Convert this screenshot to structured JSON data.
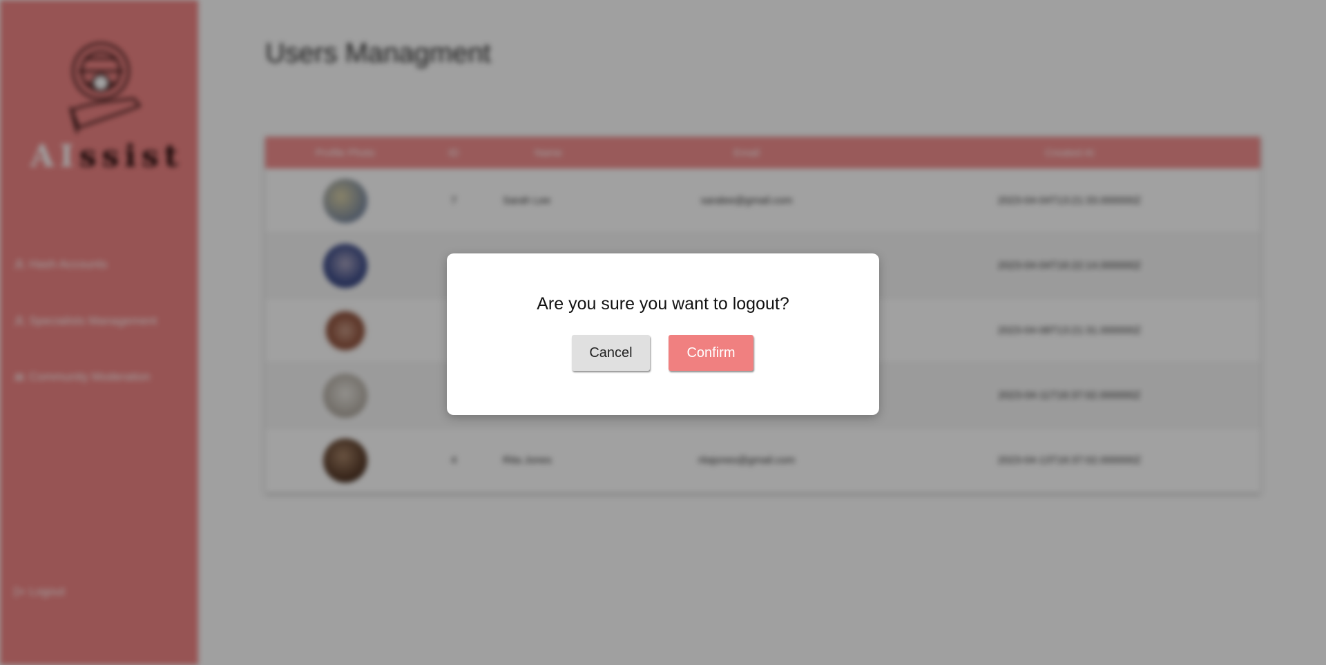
{
  "sidebar": {
    "brand_part1": "AI",
    "brand_part2": "ssist",
    "items": [
      {
        "label": "Hash Accounts",
        "icon": "user-icon"
      },
      {
        "label": "Specialists Management",
        "icon": "user-icon"
      },
      {
        "label": "Community Moderation",
        "icon": "community-icon"
      }
    ],
    "logout_label": "Logout"
  },
  "main": {
    "title": "Users Managment",
    "table": {
      "headers": [
        "Profile Photo",
        "ID",
        "Name",
        "Email",
        "Created At"
      ],
      "rows": [
        {
          "id": "7",
          "name": "Sarah Lee",
          "email": "saralee@gmail.com",
          "created": "2023-04-04T13:21:33.000000Z"
        },
        {
          "id": "",
          "name": "",
          "email": "",
          "created": "2023-04-04T16:22:14.000000Z"
        },
        {
          "id": "",
          "name": "",
          "email": "",
          "created": "2023-04-08T13:21:31.000000Z"
        },
        {
          "id": "",
          "name": "",
          "email": "",
          "created": "2023-04-11T16:37:02.000000Z"
        },
        {
          "id": "4",
          "name": "Rita Jones",
          "email": "ritajones@gmail.com",
          "created": "2023-04-13T16:37:02.000000Z"
        }
      ]
    }
  },
  "modal": {
    "message": "Are you sure you want to logout?",
    "cancel_label": "Cancel",
    "confirm_label": "Confirm"
  },
  "colors": {
    "sidebar": "#f08585",
    "accent": "#f08080",
    "table_header": "#f28f8f"
  }
}
